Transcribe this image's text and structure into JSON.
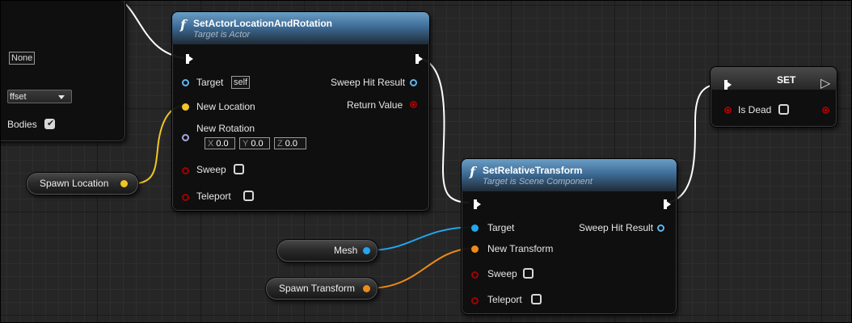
{
  "graph": {
    "colors": {
      "background": "#262626",
      "function_header": "#3e6d97",
      "object_pin": "#23a6ef",
      "vector_pin": "#f0c624",
      "transform_pin": "#f08a17",
      "rotator_pin": "#a8a6dd",
      "bool_pin": "#a30000",
      "exec_pin": "#ffffff"
    }
  },
  "partial_node": {
    "none_field": "None",
    "dropdown_value": "ffset",
    "bodies_label": "Bodies",
    "bodies_checked": true
  },
  "set_actor_node": {
    "title": "SetActorLocationAndRotation",
    "subtitle": "Target is Actor",
    "target_label": "Target",
    "target_default": "self",
    "new_location_label": "New Location",
    "new_rotation_label": "New Rotation",
    "rotation_x_axis": "X",
    "rotation_x": "0.0",
    "rotation_y_axis": "Y",
    "rotation_y": "0.0",
    "rotation_z_axis": "Z",
    "rotation_z": "0.0",
    "sweep_label": "Sweep",
    "teleport_label": "Teleport",
    "sweep_hit_result_label": "Sweep Hit Result",
    "return_value_label": "Return Value"
  },
  "spawn_location_node": {
    "label": "Spawn Location"
  },
  "set_relative_node": {
    "title": "SetRelativeTransform",
    "subtitle": "Target is Scene Component",
    "target_label": "Target",
    "new_transform_label": "New Transform",
    "sweep_label": "Sweep",
    "teleport_label": "Teleport",
    "sweep_hit_result_label": "Sweep Hit Result"
  },
  "mesh_node": {
    "label": "Mesh"
  },
  "spawn_transform_node": {
    "label": "Spawn Transform"
  },
  "set_node": {
    "title": "SET",
    "is_dead_label": "Is Dead",
    "is_dead_checked": false
  }
}
